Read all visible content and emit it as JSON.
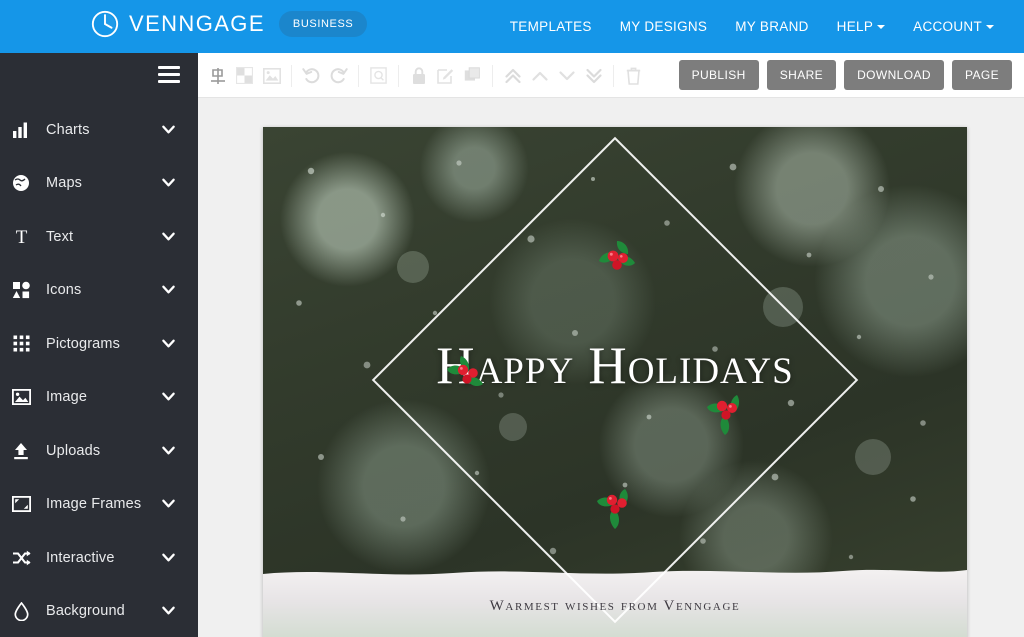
{
  "header": {
    "brand_name": "VENNGAGE",
    "brand_logo_icon": "clock-circle-logo-icon",
    "badge": "BUSINESS",
    "nav": [
      {
        "label": "TEMPLATES",
        "icon": "",
        "has_caret": false
      },
      {
        "label": "MY DESIGNS",
        "icon": "",
        "has_caret": false
      },
      {
        "label": "MY BRAND",
        "icon": "",
        "has_caret": false
      },
      {
        "label": "HELP",
        "icon": "caret-down-icon",
        "has_caret": true
      },
      {
        "label": "ACCOUNT",
        "icon": "caret-down-icon",
        "has_caret": true
      }
    ],
    "background_color": "#1596e8",
    "badge_color": "#1b86cc"
  },
  "sidebar": {
    "menu_icon": "hamburger-menu-icon",
    "background_color": "#2b2e35",
    "items": [
      {
        "label": "Charts",
        "icon": "bar-chart-icon",
        "chevron": "chevron-down-icon"
      },
      {
        "label": "Maps",
        "icon": "globe-icon",
        "chevron": "chevron-down-icon"
      },
      {
        "label": "Text",
        "icon": "text-t-icon",
        "chevron": "chevron-down-icon"
      },
      {
        "label": "Icons",
        "icon": "shapes-icon",
        "chevron": "chevron-down-icon"
      },
      {
        "label": "Pictograms",
        "icon": "grid-dots-icon",
        "chevron": "chevron-down-icon"
      },
      {
        "label": "Image",
        "icon": "picture-icon",
        "chevron": "chevron-down-icon"
      },
      {
        "label": "Uploads",
        "icon": "upload-icon",
        "chevron": "chevron-down-icon"
      },
      {
        "label": "Image Frames",
        "icon": "image-frame-icon",
        "chevron": "chevron-down-icon"
      },
      {
        "label": "Interactive",
        "icon": "shuffle-icon",
        "chevron": "chevron-down-icon"
      },
      {
        "label": "Background",
        "icon": "droplet-icon",
        "chevron": "chevron-down-icon"
      }
    ]
  },
  "toolbar": {
    "tools": [
      {
        "name": "align-icon",
        "group": 1
      },
      {
        "name": "crop-mask-icon",
        "group": 1
      },
      {
        "name": "image-swap-icon",
        "group": 1
      },
      {
        "name": "undo-icon",
        "group": 2
      },
      {
        "name": "redo-icon",
        "group": 2
      },
      {
        "name": "resize-frame-icon",
        "group": 3
      },
      {
        "name": "lock-icon",
        "group": 4
      },
      {
        "name": "edit-icon",
        "group": 4
      },
      {
        "name": "duplicate-icon",
        "group": 4
      },
      {
        "name": "bring-to-front-icon",
        "group": 5
      },
      {
        "name": "bring-forward-icon",
        "group": 5
      },
      {
        "name": "send-backward-icon",
        "group": 5
      },
      {
        "name": "send-to-back-icon",
        "group": 5
      },
      {
        "name": "trash-icon",
        "group": 6
      }
    ],
    "buttons": [
      {
        "label": "PUBLISH",
        "name": "publish-button"
      },
      {
        "label": "SHARE",
        "name": "share-button"
      },
      {
        "label": "DOWNLOAD",
        "name": "download-button"
      },
      {
        "label": "PAGE",
        "name": "page-button"
      }
    ],
    "button_color": "#7d7d7d"
  },
  "canvas": {
    "title": "Happy Holidays",
    "subtitle": "Warmest wishes from Venngage",
    "decorations": [
      "holly-top",
      "holly-left",
      "holly-right",
      "holly-bottom"
    ],
    "frame_shape": "diamond-outline",
    "frame_color": "#ffffff",
    "background_description": "dark-green-snowy-bokeh",
    "snow_color": "#e9e6e6",
    "title_color": "#ffffff",
    "subtitle_color": "#3e3a42"
  }
}
